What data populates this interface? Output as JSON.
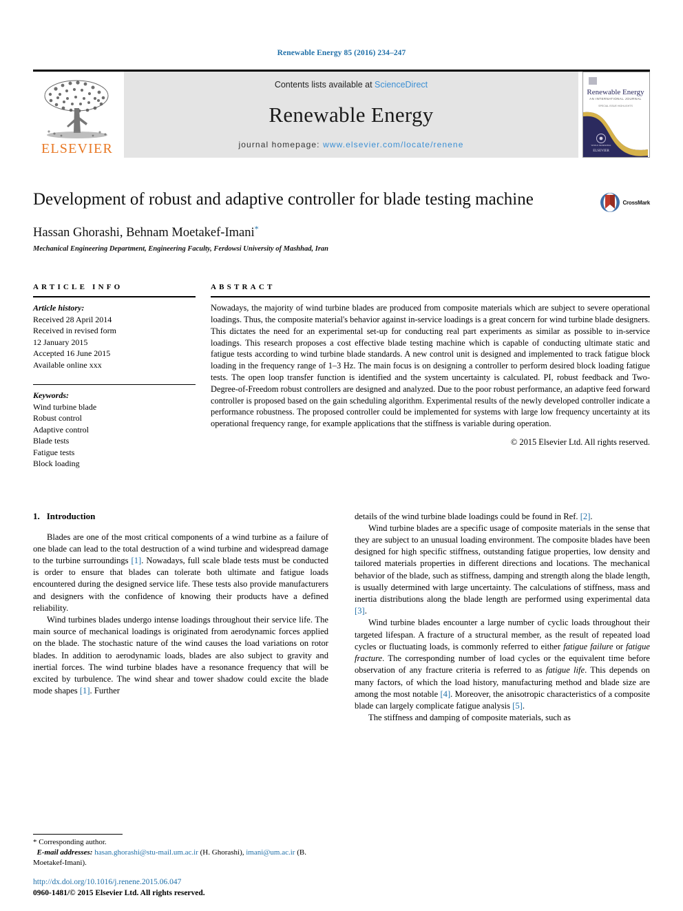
{
  "running_head": "Renewable Energy 85 (2016) 234–247",
  "masthead": {
    "elsevier_word": "ELSEVIER",
    "contents_prefix": "Contents lists available at ",
    "sciencedirect": "ScienceDirect",
    "journal_title": "Renewable Energy",
    "homepage_prefix": "journal homepage: ",
    "homepage_url": "www.elsevier.com/locate/renene",
    "cover_title": "Renewable Energy",
    "cover_subtitle": "AN INTERNATIONAL JOURNAL",
    "cover_publisher": "ELSEVIER",
    "accent_blue": "#3b8fd4",
    "elsevier_orange": "#e87722",
    "cover_navy": "#2b2a5e"
  },
  "article": {
    "title": "Development of robust and adaptive controller for blade testing machine",
    "authors": "Hassan Ghorashi, Behnam Moetakef-Imani",
    "corresponding_marker": "*",
    "affiliation": "Mechanical Engineering Department, Engineering Faculty, Ferdowsi University of Mashhad, Iran",
    "crossmark_label": "CrossMark"
  },
  "article_info": {
    "heading": "ARTICLE INFO",
    "history_label": "Article history:",
    "history": [
      "Received 28 April 2014",
      "Received in revised form",
      "12 January 2015",
      "Accepted 16 June 2015",
      "Available online xxx"
    ],
    "keywords_label": "Keywords:",
    "keywords": [
      "Wind turbine blade",
      "Robust control",
      "Adaptive control",
      "Blade tests",
      "Fatigue tests",
      "Block loading"
    ]
  },
  "abstract": {
    "heading": "ABSTRACT",
    "text": "Nowadays, the majority of wind turbine blades are produced from composite materials which are subject to severe operational loadings. Thus, the composite material's behavior against in-service loadings is a great concern for wind turbine blade designers. This dictates the need for an experimental set-up for conducting real part experiments as similar as possible to in-service loadings. This research proposes a cost effective blade testing machine which is capable of conducting ultimate static and fatigue tests according to wind turbine blade standards. A new control unit is designed and implemented to track fatigue block loading in the frequency range of 1–3 Hz. The main focus is on designing a controller to perform desired block loading fatigue tests. The open loop transfer function is identified and the system uncertainty is calculated. PI, robust feedback and Two-Degree-of-Freedom robust controllers are designed and analyzed. Due to the poor robust performance, an adaptive feed forward controller is proposed based on the gain scheduling algorithm. Experimental results of the newly developed controller indicate a performance robustness. The proposed controller could be implemented for systems with large low frequency uncertainty at its operational frequency range, for example applications that the stiffness is variable during operation.",
    "copyright": "© 2015 Elsevier Ltd. All rights reserved."
  },
  "body": {
    "section_number": "1.",
    "section_name": "Introduction",
    "left_paragraphs": [
      "Blades are one of the most critical components of a wind turbine as a failure of one blade can lead to the total destruction of a wind turbine and widespread damage to the turbine surroundings [1]. Nowadays, full scale blade tests must be conducted is order to ensure that blades can tolerate both ultimate and fatigue loads encountered during the designed service life. These tests also provide manufacturers and designers with the confidence of knowing their products have a defined reliability.",
      "Wind turbines blades undergo intense loadings throughout their service life. The main source of mechanical loadings is originated from aerodynamic forces applied on the blade. The stochastic nature of the wind causes the load variations on rotor blades. In addition to aerodynamic loads, blades are also subject to gravity and inertial forces. The wind turbine blades have a resonance frequency that will be excited by turbulence. The wind shear and tower shadow could excite the blade mode shapes [1]. Further"
    ],
    "right_paragraphs": [
      "details of the wind turbine blade loadings could be found in Ref. [2].",
      "Wind turbine blades are a specific usage of composite materials in the sense that they are subject to an unusual loading environment. The composite blades have been designed for high specific stiffness, outstanding fatigue properties, low density and tailored materials properties in different directions and locations. The mechanical behavior of the blade, such as stiffness, damping and strength along the blade length, is usually determined with large uncertainty. The calculations of stiffness, mass and inertia distributions along the blade length are performed using experimental data [3].",
      "Wind turbine blades encounter a large number of cyclic loads throughout their targeted lifespan. A fracture of a structural member, as the result of repeated load cycles or fluctuating loads, is commonly referred to either fatigue failure or fatigue fracture. The corresponding number of load cycles or the equivalent time before observation of any fracture criteria is referred to as fatigue life. This depends on many factors, of which the load history, manufacturing method and blade size are among the most notable [4]. Moreover, the anisotropic characteristics of a composite blade can largely complicate fatigue analysis [5].",
      "The stiffness and damping of composite materials, such as"
    ]
  },
  "footnote": {
    "corresponding": "* Corresponding author.",
    "email_label": "E-mail addresses:",
    "email1": "hasan.ghorashi@stu-mail.um.ac.ir",
    "email1_owner": "(H. Ghorashi),",
    "email2": "imani@um.ac.ir",
    "email2_owner": "(B. Moetakef-Imani)."
  },
  "doi_block": {
    "doi": "http://dx.doi.org/10.1016/j.renene.2015.06.047",
    "issn": "0960-1481/© 2015 Elsevier Ltd. All rights reserved."
  }
}
